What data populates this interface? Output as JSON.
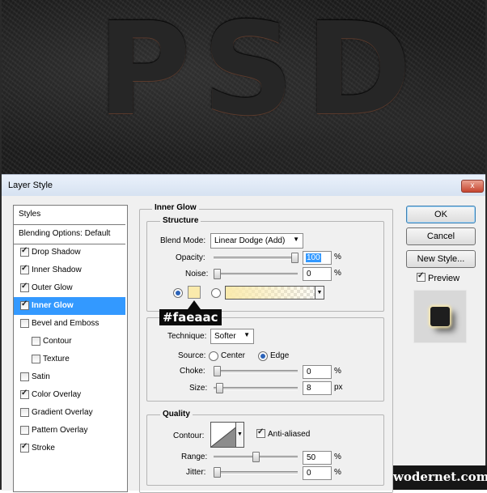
{
  "banner": {
    "text": "PSD"
  },
  "dialog": {
    "title": "Layer Style",
    "close_label": "x",
    "sidebar": [
      {
        "label": "Styles",
        "checkbox": null,
        "selected": false
      },
      {
        "label": "Blending Options: Default",
        "checkbox": null,
        "selected": false
      },
      {
        "label": "Drop Shadow",
        "checkbox": true,
        "selected": false
      },
      {
        "label": "Inner Shadow",
        "checkbox": true,
        "selected": false
      },
      {
        "label": "Outer Glow",
        "checkbox": true,
        "selected": false
      },
      {
        "label": "Inner Glow",
        "checkbox": true,
        "selected": true
      },
      {
        "label": "Bevel and Emboss",
        "checkbox": false,
        "selected": false
      },
      {
        "label": "Contour",
        "checkbox": false,
        "selected": false
      },
      {
        "label": "Texture",
        "checkbox": false,
        "selected": false
      },
      {
        "label": "Satin",
        "checkbox": false,
        "selected": false
      },
      {
        "label": "Color Overlay",
        "checkbox": true,
        "selected": false
      },
      {
        "label": "Gradient Overlay",
        "checkbox": false,
        "selected": false
      },
      {
        "label": "Pattern Overlay",
        "checkbox": false,
        "selected": false
      },
      {
        "label": "Stroke",
        "checkbox": true,
        "selected": false
      }
    ],
    "panel": {
      "title": "Inner Glow",
      "structure": {
        "title": "Structure",
        "blend_mode_label": "Blend Mode:",
        "blend_mode_value": "Linear Dodge (Add)",
        "opacity_label": "Opacity:",
        "opacity_value": "100",
        "opacity_unit": "%",
        "opacity_level": 1.0,
        "noise_label": "Noise:",
        "noise_value": "0",
        "noise_unit": "%",
        "noise_level": 0.0,
        "glow_color": "#faeaac",
        "color_mode": "solid"
      },
      "elements": {
        "technique_label": "Technique:",
        "technique_value": "Softer",
        "source_label": "Source:",
        "source_center": "Center",
        "source_edge": "Edge",
        "source_selected": "Edge",
        "choke_label": "Choke:",
        "choke_value": "0",
        "choke_unit": "%",
        "choke_level": 0.0,
        "size_label": "Size:",
        "size_value": "8",
        "size_unit": "px",
        "size_level": 0.03
      },
      "quality": {
        "title": "Quality",
        "contour_label": "Contour:",
        "anti_aliased_label": "Anti-aliased",
        "anti_aliased": true,
        "range_label": "Range:",
        "range_value": "50",
        "range_unit": "%",
        "range_level": 0.5,
        "jitter_label": "Jitter:",
        "jitter_value": "0",
        "jitter_unit": "%",
        "jitter_level": 0.0
      }
    },
    "buttons": {
      "ok": "OK",
      "cancel": "Cancel",
      "new_style": "New Style..."
    },
    "preview_label": "Preview",
    "preview_checked": true
  },
  "callout": "#faeaac",
  "watermark": "wodernet.com",
  "icons": {
    "dropdown": "chevron-down-icon",
    "check": "checkmark-icon",
    "close": "close-icon"
  }
}
